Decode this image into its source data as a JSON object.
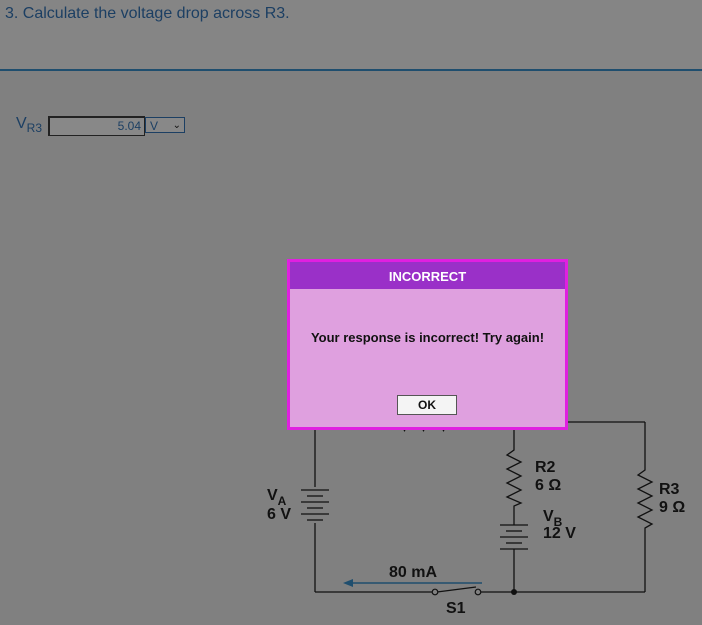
{
  "question": {
    "text": "3. Calculate the voltage drop across R3."
  },
  "answer": {
    "label_main": "V",
    "label_sub": "R3",
    "value": "5.04",
    "unit": "V"
  },
  "circuit": {
    "source_a": {
      "name": "V",
      "sub": "A",
      "voltage": "6 V"
    },
    "source_b": {
      "name": "V",
      "sub": "B",
      "voltage": "12 V"
    },
    "r2": {
      "name": "R2",
      "value": "6 Ω"
    },
    "r3": {
      "name": "R3",
      "value": "9 Ω"
    },
    "current": "80 mA",
    "switch": "S1"
  },
  "dialog": {
    "title": "INCORRECT",
    "message": "Your response is incorrect! Try again!",
    "ok_label": "OK"
  },
  "colors": {
    "dialog_title_bg": "#9a30c8",
    "dialog_body_bg": "#dfa0df",
    "dialog_border": "#e020e0",
    "question_text": "#1c3f63",
    "arrow": "#1f4e6e"
  }
}
